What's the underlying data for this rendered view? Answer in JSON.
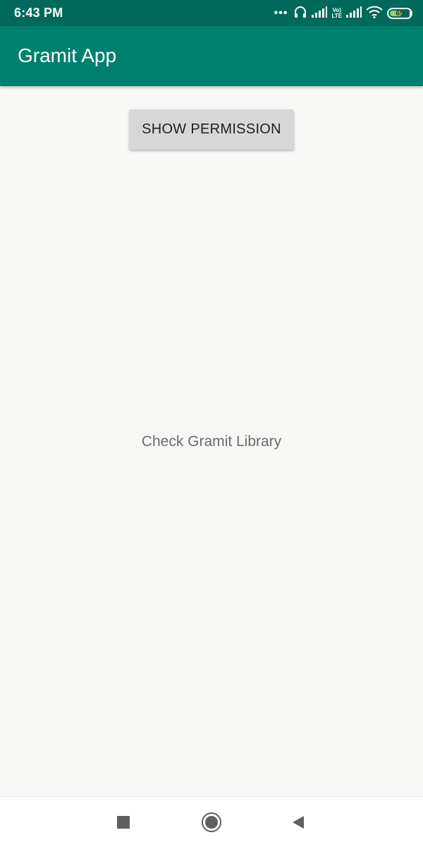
{
  "status_bar": {
    "time": "6:43 PM",
    "icons": [
      "more-dots-icon",
      "headphones-icon",
      "signal-icon",
      "volte-icon",
      "signal-icon",
      "wifi-icon",
      "battery-icon"
    ],
    "volte_top": "Vo)",
    "volte_bottom": "LTE",
    "battery_level": "65",
    "color": "#00695c"
  },
  "app_bar": {
    "title": "Gramit App",
    "color": "#00806f"
  },
  "main": {
    "show_permission_label": "SHOW PERMISSION",
    "center_text": "Check Gramit Library"
  },
  "nav_bar": {
    "icons": [
      "recents-square-icon",
      "home-circle-icon",
      "back-triangle-icon"
    ]
  }
}
